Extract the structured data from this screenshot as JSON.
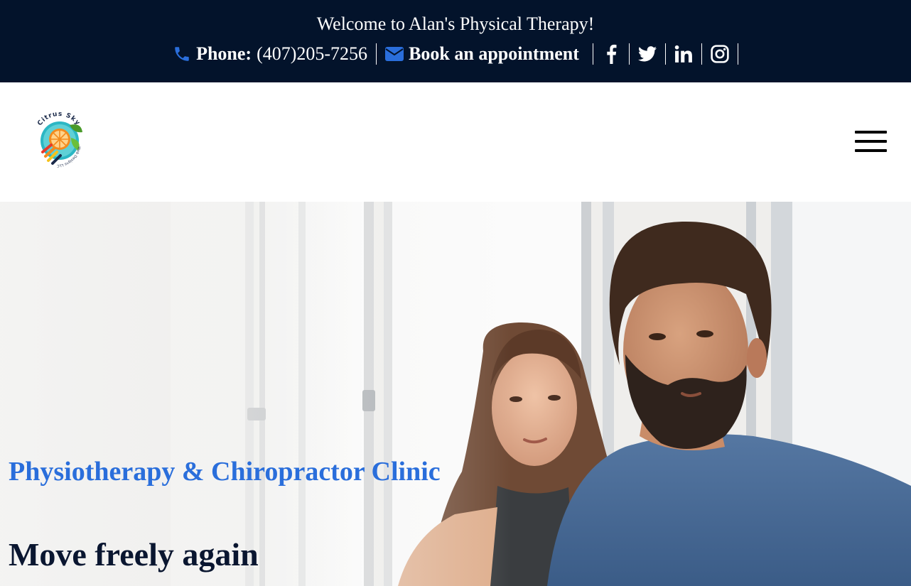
{
  "topbar": {
    "welcome": "Welcome to Alan's Physical Therapy!",
    "phone_label": "Phone:",
    "phone_number": "(407)205-7256",
    "book_label": "Book an appointment",
    "icons": [
      "phone-icon",
      "envelope-icon",
      "facebook-icon",
      "twitter-icon",
      "linkedin-icon",
      "instagram-icon"
    ],
    "colors": {
      "background": "#03132b",
      "icon_accent": "#2a6edb"
    }
  },
  "header": {
    "logo": {
      "top_text": "Citrus Sky",
      "bottom_text": "Web Designs LLC"
    },
    "menu_icon": "hamburger-icon"
  },
  "hero": {
    "subtitle": "Physiotherapy & Chiropractor Clinic",
    "headline": "Move freely again",
    "colors": {
      "subtitle": "#2a6edb",
      "headline": "#0a1630"
    }
  }
}
